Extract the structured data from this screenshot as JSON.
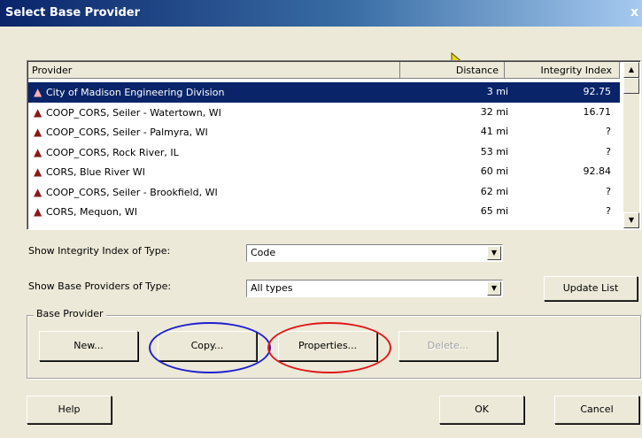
{
  "window": {
    "title": "Select Base Provider",
    "close_glyph": "x"
  },
  "list": {
    "columns": {
      "provider": "Provider",
      "distance": "Distance",
      "integrity": "Integrity Index"
    },
    "rows": [
      {
        "provider": "City of Madison Engineering Division",
        "distance": "3 mi",
        "integrity": "92.75",
        "selected": true
      },
      {
        "provider": "COOP_CORS, Seiler - Watertown, WI",
        "distance": "32 mi",
        "integrity": "16.71"
      },
      {
        "provider": "COOP_CORS, Seiler - Palmyra, WI",
        "distance": "41 mi",
        "integrity": "?"
      },
      {
        "provider": "COOP_CORS, Rock River, IL",
        "distance": "53 mi",
        "integrity": "?"
      },
      {
        "provider": "CORS, Blue River WI",
        "distance": "60 mi",
        "integrity": "92.84"
      },
      {
        "provider": "COOP_CORS, Seiler - Brookfield, WI",
        "distance": "62 mi",
        "integrity": "?"
      },
      {
        "provider": "CORS, Mequon, WI",
        "distance": "65 mi",
        "integrity": "?"
      }
    ]
  },
  "integrity_type": {
    "label": "Show Integrity Index of Type:",
    "value": "Code"
  },
  "provider_type": {
    "label": "Show Base Providers of Type:",
    "value": "All types"
  },
  "update_list_label": "Update List",
  "base_provider_group": {
    "label": "Base Provider",
    "new_label": "New...",
    "copy_label": "Copy...",
    "properties_label": "Properties...",
    "delete_label": "Delete..."
  },
  "help_label": "Help",
  "ok_label": "OK",
  "cancel_label": "Cancel",
  "annotation_colors": {
    "copy_highlight": "#1f1fd0",
    "properties_highlight": "#e01818"
  }
}
